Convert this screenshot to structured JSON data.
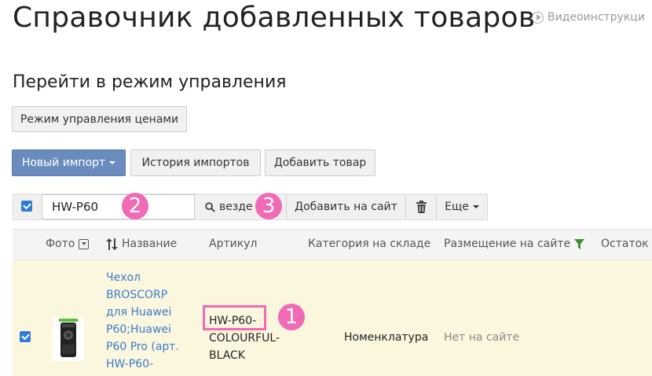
{
  "page": {
    "title": "Справочник добавленных товаров",
    "video_link": "Видеоинструкци"
  },
  "management": {
    "title": "Перейти в режим управления",
    "price_mode_button": "Режим управления ценами"
  },
  "actions": {
    "new_import": "Новый импорт",
    "import_history": "История импортов",
    "add_product": "Добавить товар"
  },
  "toolbar": {
    "search_value": "HW-P60",
    "search_scope": "везде",
    "add_to_site": "Добавить на сайт",
    "more": "Еще"
  },
  "annotations": {
    "one": "1",
    "two": "2",
    "three": "3",
    "color": "#f06ab5"
  },
  "table": {
    "columns": {
      "photo": "Фото",
      "name": "Название",
      "article": "Артикул",
      "category": "Категория на складе",
      "placement": "Размещение на сайте",
      "stock": "Остаток"
    },
    "rows": [
      {
        "selected": true,
        "name": "Чехол BROSCORP для Huawei P60;Huawei P60 Pro (арт. HW-P60-",
        "article_line1": "HW-P60-",
        "article_line2": "COLOURFUL-",
        "article_line3": "BLACK",
        "category": "Номенклатура",
        "placement": "Нет на сайте"
      }
    ]
  },
  "colors": {
    "primary_button": "#6a8bbd",
    "link": "#3a7bc8",
    "checkbox": "#2f7bd8",
    "row_highlight": "#fbf7df",
    "filter_icon": "#3a8a2e"
  }
}
